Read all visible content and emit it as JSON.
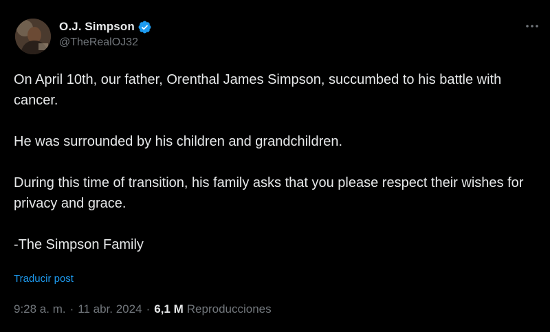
{
  "author": {
    "display_name": "O.J. Simpson",
    "handle": "@TheRealOJ32",
    "verified": true
  },
  "menu": {
    "more_icon": "more-horizontal-icon"
  },
  "tweet": {
    "paragraphs": [
      "On April 10th, our father, Orenthal James Simpson, succumbed to his battle with cancer.",
      "He was surrounded by his children and grandchildren.",
      "During this time of transition, his family asks that you please respect their wishes for privacy and grace.",
      "-The Simpson Family"
    ],
    "translate_label": "Traducir post"
  },
  "meta": {
    "time": "9:28 a. m.",
    "separator": "·",
    "date": "11 abr. 2024",
    "views_count": "6,1 M",
    "views_label": "Reproducciones"
  },
  "colors": {
    "background": "#000000",
    "text_primary": "#e7e9ea",
    "text_secondary": "#71767b",
    "accent": "#1d9bf0"
  }
}
